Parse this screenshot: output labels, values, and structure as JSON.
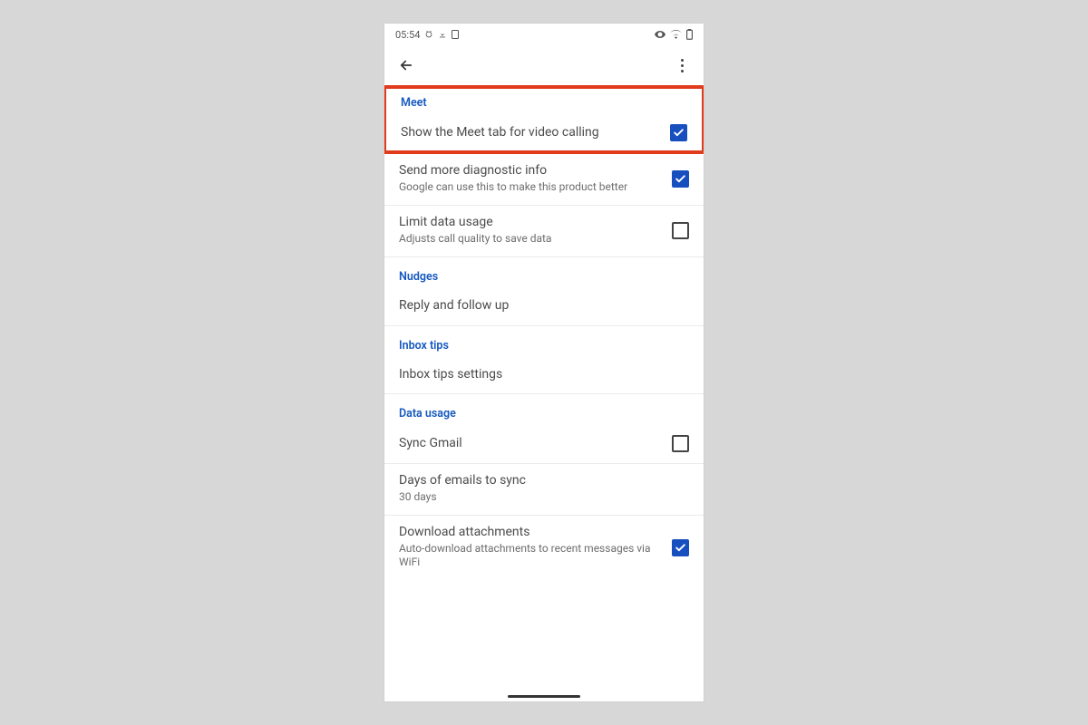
{
  "status": {
    "time": "05:54"
  },
  "sections": {
    "meet": {
      "header": "Meet",
      "show_meet_tab": {
        "title": "Show the Meet tab for video calling",
        "checked": true
      },
      "diagnostic": {
        "title": "Send more diagnostic info",
        "subtitle": "Google can use this to make this product better",
        "checked": true
      },
      "limit_data": {
        "title": "Limit data usage",
        "subtitle": "Adjusts call quality to save data",
        "checked": false
      }
    },
    "nudges": {
      "header": "Nudges",
      "reply": {
        "title": "Reply and follow up"
      }
    },
    "inbox_tips": {
      "header": "Inbox tips",
      "settings": {
        "title": "Inbox tips settings"
      }
    },
    "data_usage": {
      "header": "Data usage",
      "sync": {
        "title": "Sync Gmail",
        "checked": false
      },
      "days": {
        "title": "Days of emails to sync",
        "subtitle": "30 days"
      },
      "download": {
        "title": "Download attachments",
        "subtitle": "Auto-download attachments to recent messages via WiFi",
        "checked": true
      }
    }
  }
}
